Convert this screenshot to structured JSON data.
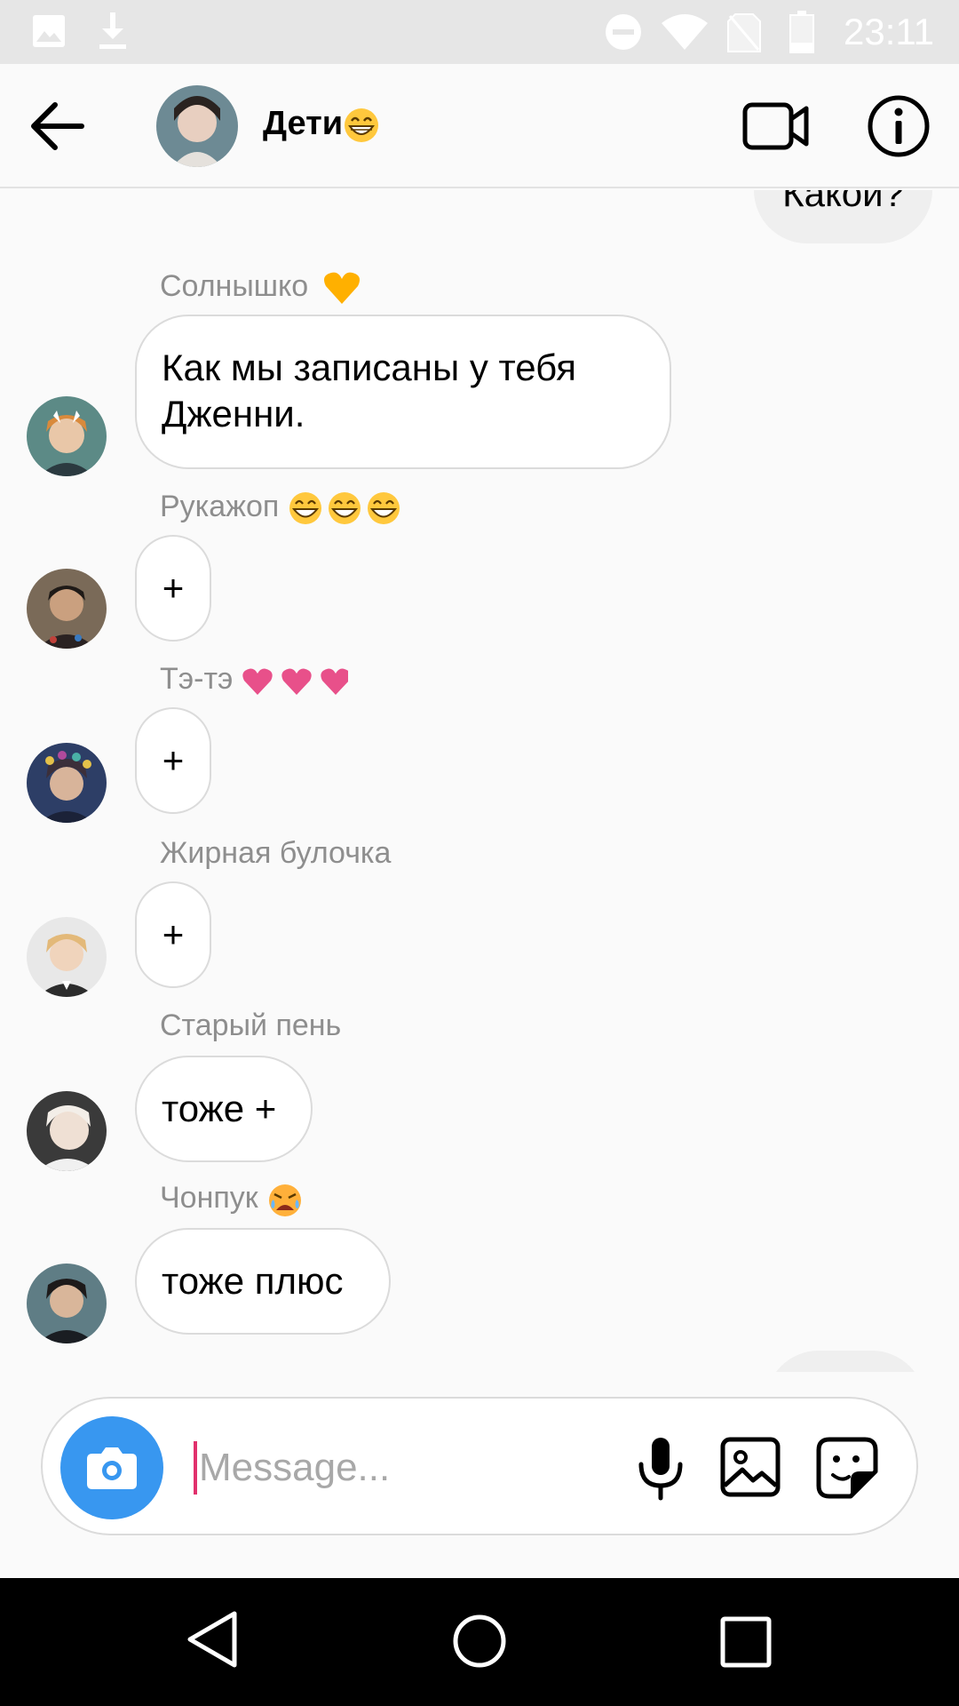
{
  "status_bar": {
    "time": "23:11",
    "icons": [
      "image-icon",
      "download-icon",
      "do-not-disturb-icon",
      "wifi-icon",
      "no-sim-icon",
      "battery-icon"
    ]
  },
  "header": {
    "title": "Дети",
    "title_emoji": "grinning-face-emoji",
    "buttons": [
      "back-arrow-icon",
      "video-call-icon",
      "info-icon"
    ]
  },
  "chat": {
    "partial_outgoing_top": "Какой?",
    "messages": [
      {
        "sender": "Солнышко",
        "sender_emoji": "yellow-heart-emoji",
        "lines": [
          "Как мы записаны у тебя",
          "Дженни."
        ],
        "avatar": "avatar-solnyshko"
      },
      {
        "sender": "Рукажоп",
        "sender_emoji": "grinning-face-emoji x3",
        "lines": [
          "+"
        ],
        "avatar": "avatar-rukazhop"
      },
      {
        "sender": "Тэ-тэ",
        "sender_emoji": "pink-heart-emoji x3",
        "lines": [
          "+"
        ],
        "avatar": "avatar-te-te"
      },
      {
        "sender": "Жирная булочка",
        "sender_emoji": "",
        "lines": [
          "+"
        ],
        "avatar": "avatar-zhirnaya-bulochka"
      },
      {
        "sender": "Старый пень",
        "sender_emoji": "",
        "lines": [
          "тоже +"
        ],
        "avatar": "avatar-staryi-pen"
      },
      {
        "sender": "Чонпук",
        "sender_emoji": "crying-face-emoji",
        "lines": [
          "тоже плюс"
        ],
        "avatar": "avatar-chonpuk"
      }
    ]
  },
  "composer": {
    "placeholder": "Message...",
    "value": "",
    "buttons": [
      "camera-icon",
      "microphone-icon",
      "gallery-icon",
      "sticker-icon"
    ]
  },
  "nav_bar": {
    "buttons": [
      "nav-back-icon",
      "nav-home-icon",
      "nav-recents-icon"
    ]
  },
  "colors": {
    "accent": "#3897f0",
    "bubble_border": "#dbdbdb",
    "sender_text": "#8e8e8e",
    "outgoing_bubble": "#efefef",
    "cursor": "#e1306c"
  }
}
